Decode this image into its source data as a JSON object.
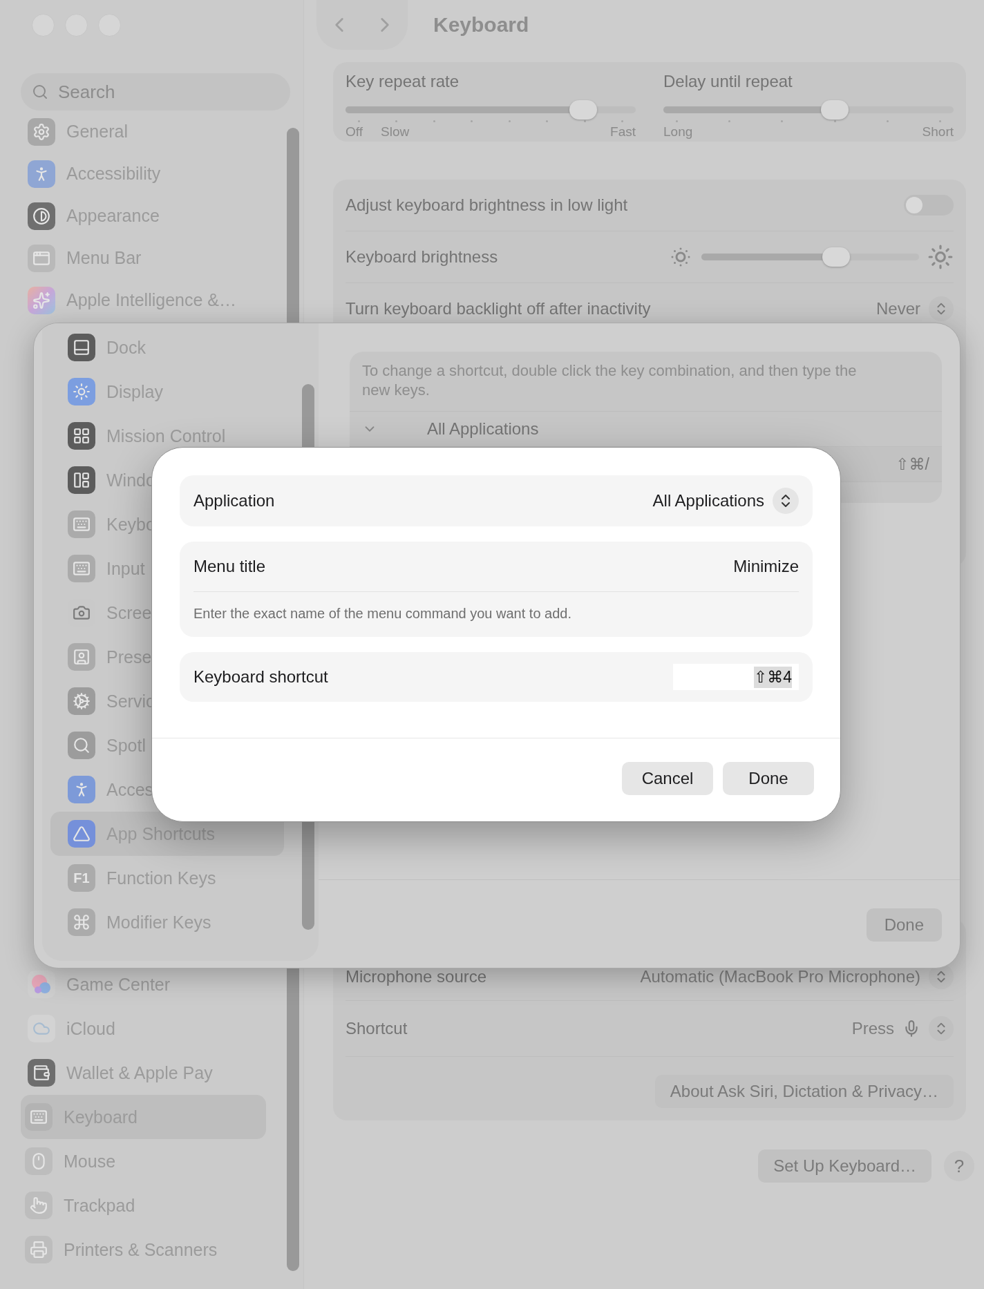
{
  "window": {
    "title": "Keyboard"
  },
  "sidebar": {
    "search": {
      "placeholder": "Search"
    },
    "groups": [
      [
        {
          "label": "General",
          "selected": false
        },
        {
          "label": "Accessibility",
          "selected": false
        },
        {
          "label": "Appearance",
          "selected": false
        },
        {
          "label": "Menu Bar",
          "selected": false
        },
        {
          "label": "Apple Intelligence &…",
          "selected": false
        }
      ],
      [
        {
          "label": "Game Center",
          "selected": false
        },
        {
          "label": "iCloud",
          "selected": false
        },
        {
          "label": "Wallet & Apple Pay",
          "selected": false
        }
      ],
      [
        {
          "label": "Keyboard",
          "selected": true
        },
        {
          "label": "Mouse",
          "selected": false
        },
        {
          "label": "Trackpad",
          "selected": false
        },
        {
          "label": "Printers & Scanners",
          "selected": false
        }
      ]
    ]
  },
  "sliders": [
    {
      "label": "Key repeat rate",
      "level": 0.82,
      "ticks": [
        "Off",
        "Slow",
        "Fast"
      ]
    },
    {
      "label": "Delay until repeat",
      "level": 0.59,
      "ticks": [
        "Long",
        "Short"
      ]
    }
  ],
  "brightness": {
    "rows": [
      {
        "kind": "toggle",
        "label": "Adjust keyboard brightness in low light",
        "on": false
      },
      {
        "kind": "slider",
        "label": "Keyboard brightness",
        "level": 0.62
      },
      {
        "kind": "popup",
        "label": "Turn keyboard backlight off after inactivity",
        "value": "Never"
      }
    ]
  },
  "dictation": {
    "rows": [
      {
        "kind": "popup",
        "label": "Microphone source",
        "value": "Automatic (MacBook Pro Microphone)"
      },
      {
        "kind": "mic",
        "label": "Shortcut",
        "value": "Press"
      }
    ],
    "about_button": "About Ask Siri, Dictation & Privacy…"
  },
  "footer": {
    "setup_button": "Set Up Keyboard…",
    "help_button": "?"
  },
  "sheet": {
    "sidebar": [
      {
        "label": "Dock",
        "selected": false
      },
      {
        "label": "Display",
        "selected": false
      },
      {
        "label": "Mission Control",
        "selected": false
      },
      {
        "label": "Windo",
        "selected": false
      },
      {
        "label": "Keybo",
        "selected": false
      },
      {
        "label": "Input",
        "selected": false
      },
      {
        "label": "Scree",
        "selected": false
      },
      {
        "label": "Prese",
        "selected": false
      },
      {
        "label": "Servic",
        "selected": false
      },
      {
        "label": "Spotl",
        "selected": false
      },
      {
        "label": "Acces",
        "selected": false
      },
      {
        "label": "App Shortcuts",
        "selected": true
      },
      {
        "label": "Function Keys",
        "selected": false,
        "badge": "F1"
      },
      {
        "label": "Modifier Keys",
        "selected": false
      }
    ],
    "hint": "To change a shortcut, double click the key combination, and then type the new keys.",
    "group": {
      "label": "All Applications",
      "expanded": true,
      "shortcuts": [
        "⇧⌘/"
      ]
    },
    "done_button": "Done"
  },
  "dialog": {
    "application": {
      "label": "Application",
      "value": "All Applications"
    },
    "menu_title": {
      "label": "Menu title",
      "value": "Minimize",
      "hint": "Enter the exact name of the menu command you want to add."
    },
    "shortcut": {
      "label": "Keyboard shortcut",
      "value": "⇧⌘4"
    },
    "buttons": [
      "Cancel",
      "Done"
    ]
  }
}
